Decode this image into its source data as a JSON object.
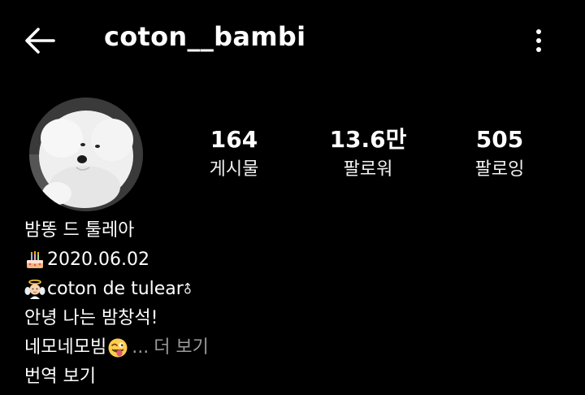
{
  "header": {
    "username": "coton__bambi"
  },
  "stats": {
    "posts": {
      "value": "164",
      "label": "게시물"
    },
    "followers": {
      "value": "13.6만",
      "label": "팔로워"
    },
    "following": {
      "value": "505",
      "label": "팔로잉"
    }
  },
  "bio": {
    "name": "밤똥 드 툴레아",
    "birthday": "2020.06.02",
    "breed": "coton de tulear",
    "line4": "안녕 나는 밤창석!",
    "line5": "네모네모빔",
    "ellipsis": "...",
    "more_label": "더 보기",
    "translate_label": "번역 보기"
  },
  "icons": {
    "back": "arrow-left-icon",
    "more": "vertical-dots-icon",
    "birthday": "birthday-cake-emoji",
    "angel": "baby-angel-emoji",
    "male": "male-sign-icon",
    "tongue": "winking-face-tongue-emoji"
  },
  "colors": {
    "background": "#000000",
    "text": "#ffffff",
    "muted": "#9a9a9a"
  }
}
